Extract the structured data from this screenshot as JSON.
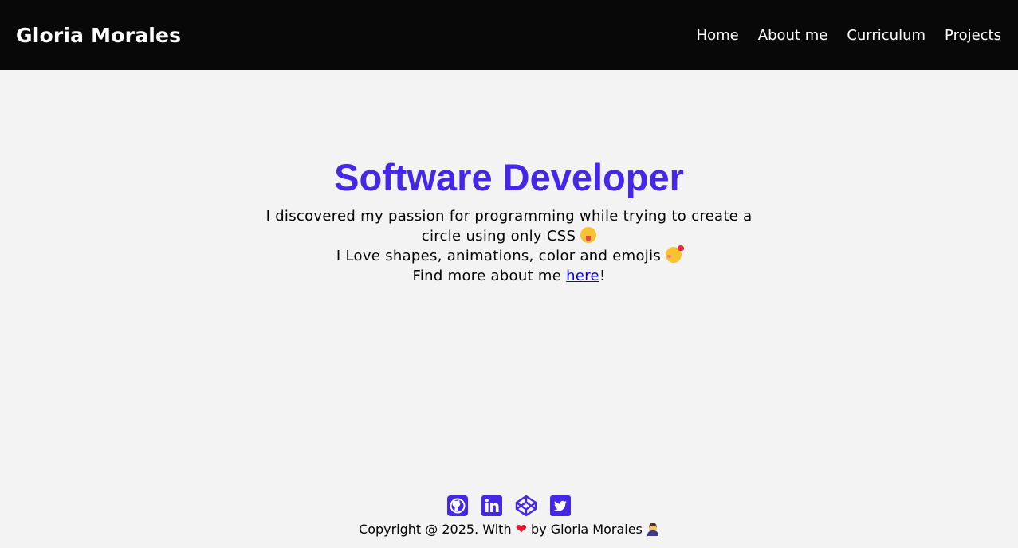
{
  "header": {
    "brand": "Gloria Morales",
    "nav": [
      {
        "label": "Home"
      },
      {
        "label": "About me"
      },
      {
        "label": "Curriculum"
      },
      {
        "label": "Projects"
      }
    ]
  },
  "hero": {
    "title": "Software Developer",
    "line1": "I discovered my passion for programming while trying to create a circle using only CSS",
    "line2": "I Love shapes, animations, color and emojis",
    "line3_prefix": "Find more about me ",
    "line3_link": "here",
    "line3_suffix": "!"
  },
  "footer": {
    "socials": [
      {
        "icon": "github-icon"
      },
      {
        "icon": "linkedin-icon"
      },
      {
        "icon": "codepen-icon"
      },
      {
        "icon": "twitter-icon"
      }
    ],
    "copyright_prefix": "Copyright @ 2025. With",
    "heart": "❤",
    "copyright_suffix": "by Gloria Morales"
  },
  "colors": {
    "accent": "#4527e8",
    "navbar": "#080808",
    "background": "#f3f3f3",
    "link": "#0000ee"
  }
}
